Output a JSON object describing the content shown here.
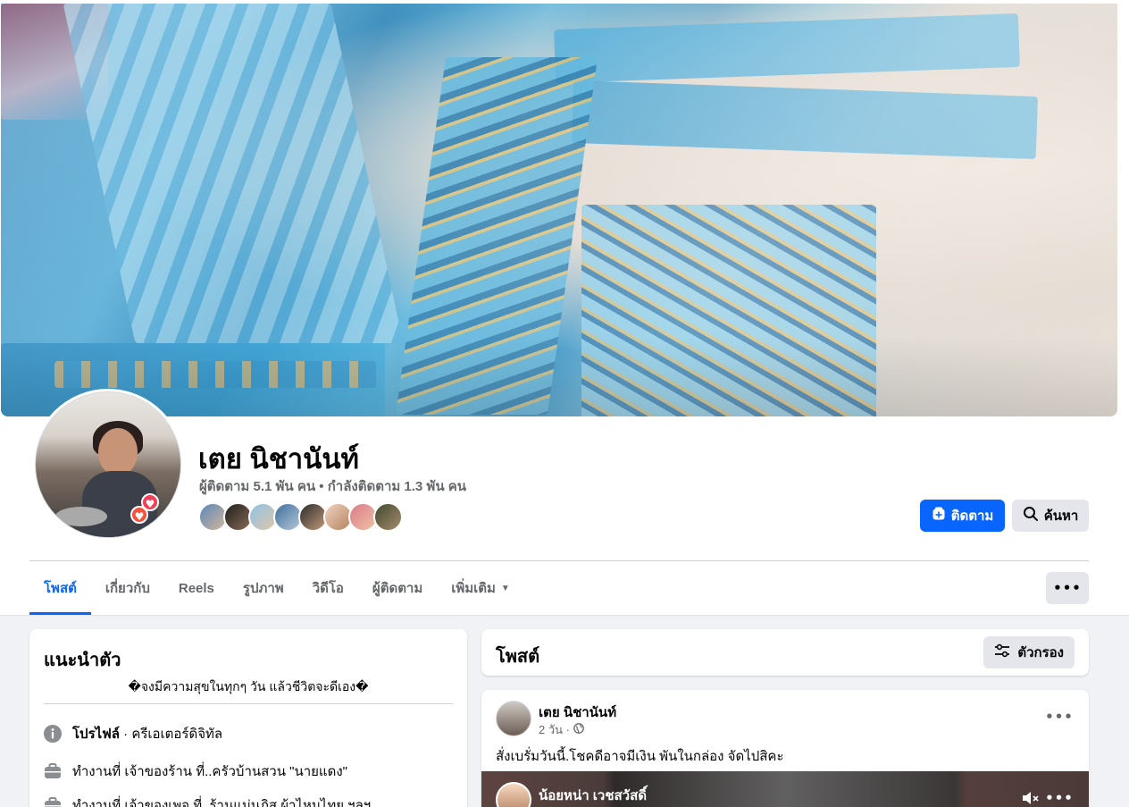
{
  "profile": {
    "name": "เตย นิชานันท์",
    "followers_summary": "ผู้ติดตาม 5.1 พัน คน • กำลังติดตาม 1.3 พัน คน"
  },
  "actions": {
    "follow_label": "ติดตาม",
    "search_label": "ค้นหา"
  },
  "tabs": [
    {
      "label": "โพสต์"
    },
    {
      "label": "เกี่ยวกับ"
    },
    {
      "label": "Reels"
    },
    {
      "label": "รูปภาพ"
    },
    {
      "label": "วิดีโอ"
    },
    {
      "label": "ผู้ติดตาม"
    },
    {
      "label": "เพิ่มเติม"
    }
  ],
  "more_menu_label": "•••",
  "intro": {
    "title": "แนะนำตัว",
    "bio": "�จงมีความสุขในทุกๆ วัน แล้วชีวิตจะดีเอง�",
    "profile_label": "โปรไฟล์",
    "profile_category": " · ครีเอเตอร์ดิจิทัล",
    "work_text": "ทำงานที่ เจ้าของร้าน ที่..ครัวบ้านสวน \"นายแดง\"",
    "work_text_2": "ทำงานที่ เจ้าของเพจ ที่..ร้านแม่นภิส ผ้าไหมไทย.ฯลฯ"
  },
  "posts_section": {
    "title": "โพสต์",
    "filter_label": "ตัวกรอง"
  },
  "post": {
    "author": "เตย นิชานันท์",
    "time": "2 วัน ·",
    "text": "สั่งเบรั่มวันนี้.โชคดีอาจมีเงิน พันในกล่อง จัดไปสิคะ",
    "menu_label": "•••",
    "media_author": "น้อยหน่า เวชสวัสดิ์",
    "media_menu_label": "•••"
  },
  "colors": {
    "accent": "#0866ff",
    "text_secondary": "#65676b",
    "button_gray": "#e4e6eb",
    "page_bg": "#f0f2f5"
  }
}
